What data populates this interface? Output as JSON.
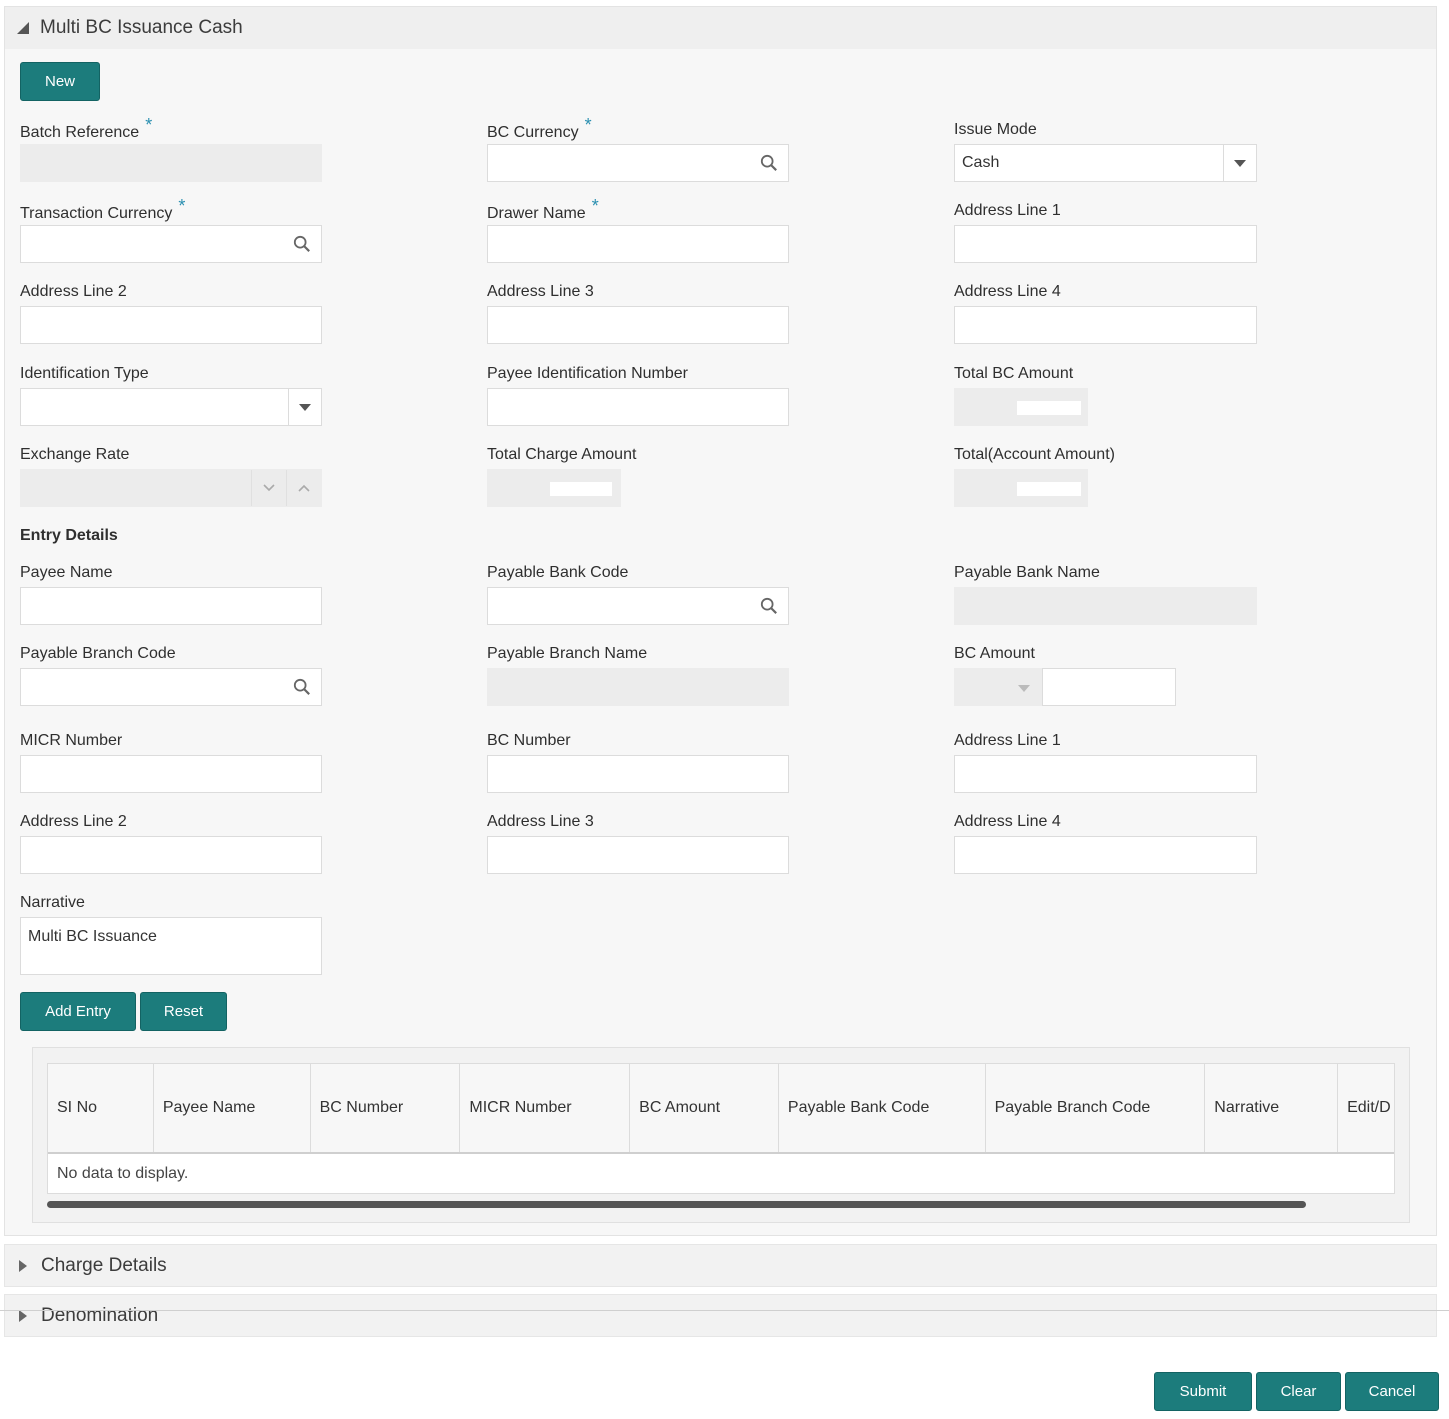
{
  "panel": {
    "title": "Multi BC Issuance Cash"
  },
  "buttons": {
    "new": "New",
    "add_entry": "Add Entry",
    "reset": "Reset",
    "submit": "Submit",
    "clear": "Clear",
    "cancel": "Cancel"
  },
  "form": {
    "batch_reference": {
      "label": "Batch Reference",
      "required": "*"
    },
    "bc_currency": {
      "label": "BC Currency",
      "required": "*"
    },
    "issue_mode": {
      "label": "Issue Mode",
      "value": "Cash"
    },
    "transaction_currency": {
      "label": "Transaction Currency",
      "required": "*"
    },
    "drawer_name": {
      "label": "Drawer Name",
      "required": "*"
    },
    "address_line_1": {
      "label": "Address Line 1"
    },
    "address_line_2": {
      "label": "Address Line 2"
    },
    "address_line_3": {
      "label": "Address Line 3"
    },
    "address_line_4": {
      "label": "Address Line 4"
    },
    "identification_type": {
      "label": "Identification Type"
    },
    "payee_identification_number": {
      "label": "Payee Identification Number"
    },
    "total_bc_amount": {
      "label": "Total BC Amount"
    },
    "exchange_rate": {
      "label": "Exchange Rate"
    },
    "total_charge_amount": {
      "label": "Total Charge Amount"
    },
    "total_account_amount": {
      "label": "Total(Account Amount)"
    }
  },
  "entry": {
    "title": "Entry Details",
    "payee_name": {
      "label": "Payee Name"
    },
    "payable_bank_code": {
      "label": "Payable Bank Code"
    },
    "payable_bank_name": {
      "label": "Payable Bank Name"
    },
    "payable_branch_code": {
      "label": "Payable Branch Code"
    },
    "payable_branch_name": {
      "label": "Payable Branch Name"
    },
    "bc_amount": {
      "label": "BC Amount"
    },
    "micr_number": {
      "label": "MICR Number"
    },
    "bc_number": {
      "label": "BC Number"
    },
    "address_line_1": {
      "label": "Address Line 1"
    },
    "address_line_2": {
      "label": "Address Line 2"
    },
    "address_line_3": {
      "label": "Address Line 3"
    },
    "address_line_4": {
      "label": "Address Line 4"
    },
    "narrative": {
      "label": "Narrative",
      "value": "Multi BC Issuance"
    }
  },
  "table": {
    "columns": [
      "SI No",
      "Payee Name",
      "BC Number",
      "MICR Number",
      "BC Amount",
      "Payable Bank Code",
      "Payable Branch Code",
      "Narrative",
      "Edit/D"
    ],
    "empty_text": "No data to display."
  },
  "sections": {
    "charge_details": "Charge Details",
    "denomination": "Denomination"
  },
  "colors": {
    "primary_button": "#1c7c7c",
    "required_star": "#2a8fb0"
  }
}
